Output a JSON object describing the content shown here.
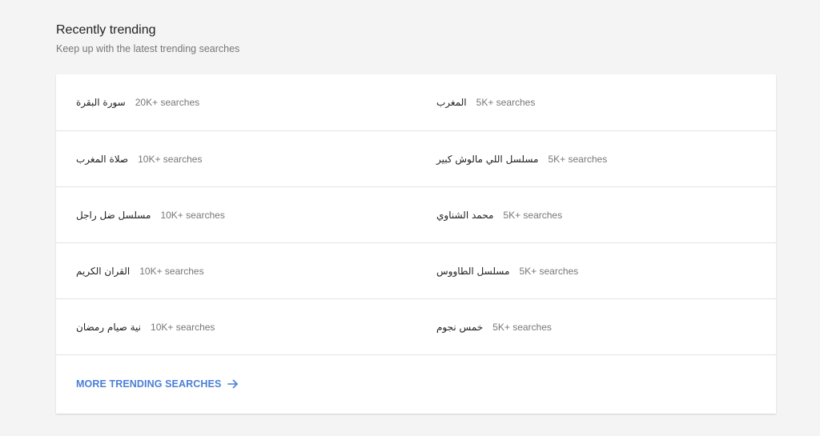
{
  "header": {
    "title": "Recently trending",
    "subtitle": "Keep up with the latest trending searches"
  },
  "trending": {
    "rows": [
      {
        "left": {
          "query": "سورة البقرة",
          "count": "20K+ searches"
        },
        "right": {
          "query": "المغرب",
          "count": "5K+ searches"
        }
      },
      {
        "left": {
          "query": "صلاة المغرب",
          "count": "10K+ searches"
        },
        "right": {
          "query": "مسلسل اللي مالوش كبير",
          "count": "5K+ searches"
        }
      },
      {
        "left": {
          "query": "مسلسل ضل راجل",
          "count": "10K+ searches"
        },
        "right": {
          "query": "محمد الشناوي",
          "count": "5K+ searches"
        }
      },
      {
        "left": {
          "query": "القران الكريم",
          "count": "10K+ searches"
        },
        "right": {
          "query": "مسلسل الطاووس",
          "count": "5K+ searches"
        }
      },
      {
        "left": {
          "query": "نية صيام رمضان",
          "count": "10K+ searches"
        },
        "right": {
          "query": "خمس نجوم",
          "count": "5K+ searches"
        }
      }
    ]
  },
  "footer": {
    "more_label": "MORE TRENDING SEARCHES",
    "arrow_icon": "arrow-right-icon",
    "accent_color": "#4a7fd6"
  }
}
